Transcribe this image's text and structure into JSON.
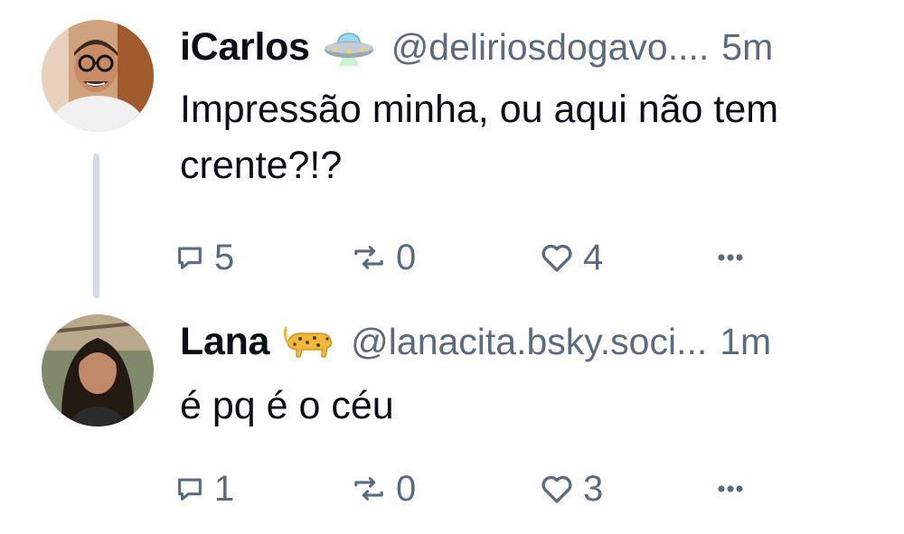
{
  "posts": [
    {
      "display_name": "iCarlos",
      "emoji": "flying-saucer-emoji",
      "handle": "@deliriosdogavo....",
      "time": "5m",
      "text": "Impressão minha, ou aqui não tem crente?!?",
      "reply_count": "5",
      "repost_count": "0",
      "like_count": "4"
    },
    {
      "display_name": "Lana",
      "emoji": "leopard-emoji",
      "handle": "@lanacita.bsky.soci...",
      "time": "1m",
      "text": "é pq é o céu",
      "reply_count": "1",
      "repost_count": "0",
      "like_count": "3"
    }
  ],
  "icons": {
    "reply": "reply-icon",
    "repost": "repost-icon",
    "like": "heart-icon",
    "more": "more-options-icon"
  },
  "colors": {
    "text": "#0b0f14",
    "muted": "#5b6b7c",
    "thread_line": "#d4dbe2",
    "background": "#ffffff"
  }
}
